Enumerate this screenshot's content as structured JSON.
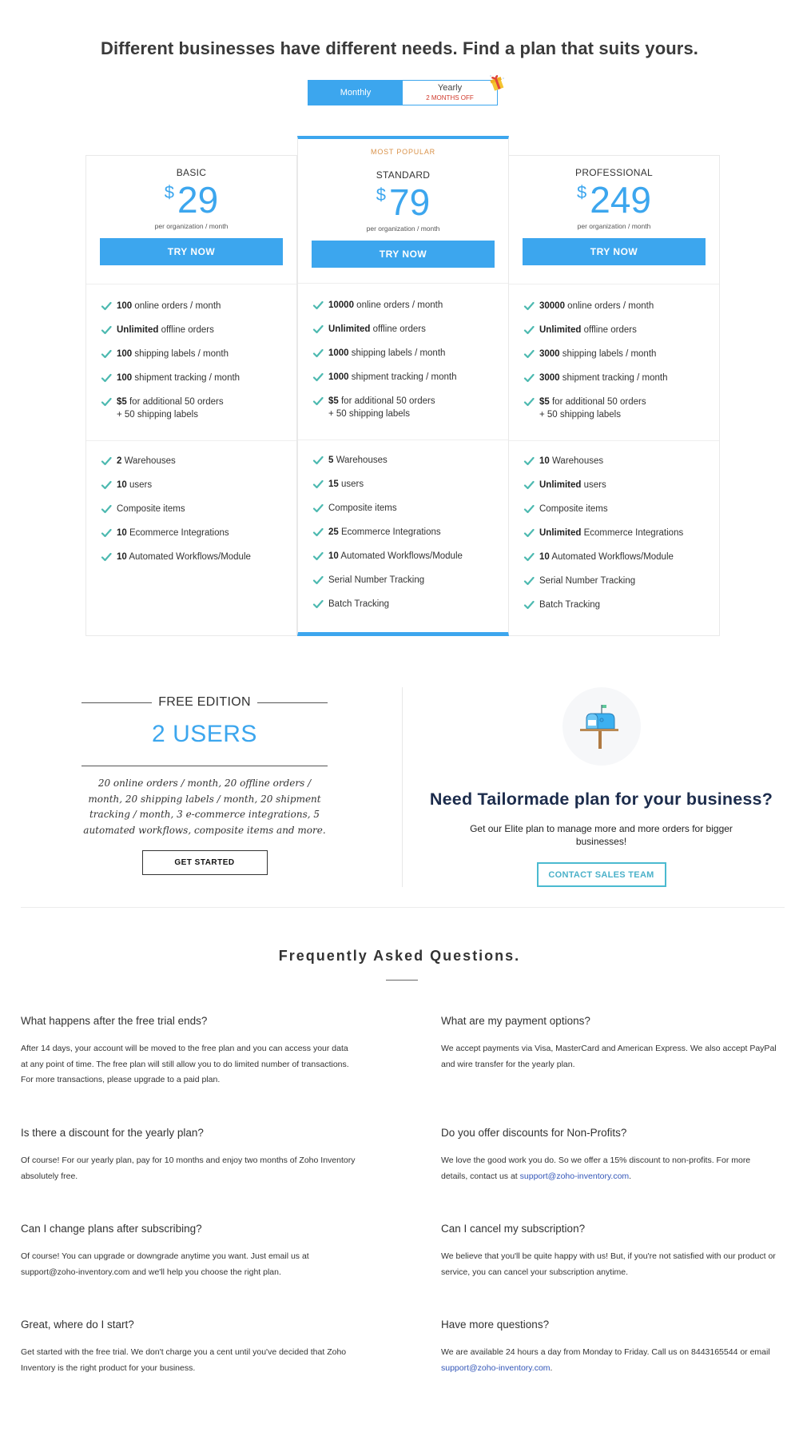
{
  "headline": "Different businesses have different needs. Find a plan that suits yours.",
  "billing": {
    "monthly_label": "Monthly",
    "yearly_label": "Yearly",
    "yearly_badge": "2 MONTHS OFF",
    "selected": "Monthly"
  },
  "colors": {
    "accent": "#3ca6ee",
    "popular": "#d9924a",
    "check": "#4cb9b0",
    "tailor_title": "#1c2c4c",
    "contact_button": "#4bbad0",
    "discount_red": "#d0392b",
    "link": "#3457b8"
  },
  "plans": [
    {
      "name": "BASIC",
      "currency": "$",
      "price": "29",
      "period": "per organization / month",
      "cta": "TRY NOW",
      "features_a": [
        {
          "bold": "100",
          "text": " online orders / month"
        },
        {
          "bold": "Unlimited",
          "text": " offline orders"
        },
        {
          "bold": "100",
          "text": " shipping labels / month"
        },
        {
          "bold": "100",
          "text": " shipment tracking / month"
        },
        {
          "bold": "$5",
          "text": " for additional 50 orders",
          "line2": "+ 50 shipping labels"
        }
      ],
      "features_b": [
        {
          "bold": "2",
          "text": " Warehouses"
        },
        {
          "bold": "10",
          "text": " users"
        },
        {
          "bold": "",
          "text": "Composite items"
        },
        {
          "bold": "10",
          "text": " Ecommerce Integrations"
        },
        {
          "bold": "10",
          "text": " Automated Workflows/Module"
        }
      ]
    },
    {
      "name": "STANDARD",
      "badge": "MOST POPULAR",
      "currency": "$",
      "price": "79",
      "period": "per organization / month",
      "cta": "TRY NOW",
      "features_a": [
        {
          "bold": "10000",
          "text": " online orders / month"
        },
        {
          "bold": "Unlimited",
          "text": " offline orders"
        },
        {
          "bold": "1000",
          "text": " shipping labels / month"
        },
        {
          "bold": "1000",
          "text": " shipment tracking / month"
        },
        {
          "bold": "$5",
          "text": " for additional 50 orders",
          "line2": "+ 50 shipping labels"
        }
      ],
      "features_b": [
        {
          "bold": "5",
          "text": " Warehouses"
        },
        {
          "bold": "15",
          "text": " users"
        },
        {
          "bold": "",
          "text": "Composite items"
        },
        {
          "bold": "25",
          "text": " Ecommerce Integrations"
        },
        {
          "bold": "10",
          "text": " Automated Workflows/Module"
        },
        {
          "bold": "",
          "text": "Serial Number Tracking"
        },
        {
          "bold": "",
          "text": "Batch Tracking"
        }
      ]
    },
    {
      "name": "PROFESSIONAL",
      "currency": "$",
      "price": "249",
      "period": "per organization / month",
      "cta": "TRY NOW",
      "features_a": [
        {
          "bold": "30000",
          "text": " online orders / month"
        },
        {
          "bold": "Unlimited",
          "text": " offline orders"
        },
        {
          "bold": "3000",
          "text": " shipping labels / month"
        },
        {
          "bold": "3000",
          "text": " shipment tracking / month"
        },
        {
          "bold": "$5",
          "text": " for additional 50 orders",
          "line2": "+ 50 shipping labels"
        }
      ],
      "features_b": [
        {
          "bold": "10",
          "text": " Warehouses"
        },
        {
          "bold": "Unlimited",
          "text": " users"
        },
        {
          "bold": "",
          "text": "Composite items"
        },
        {
          "bold": "Unlimited",
          "text": " Ecommerce Integrations"
        },
        {
          "bold": "10",
          "text": " Automated Workflows/Module"
        },
        {
          "bold": "",
          "text": "Serial Number Tracking"
        },
        {
          "bold": "",
          "text": "Batch Tracking"
        }
      ]
    }
  ],
  "free_edition": {
    "title": "FREE EDITION",
    "users": "2 USERS",
    "description": "20 online orders / month, 20 offline orders / month, 20 shipping labels / month, 20 shipment tracking / month, 3 e-commerce integrations, 5 automated workflows, composite items and more.",
    "cta": "GET STARTED"
  },
  "tailormade": {
    "icon": "mailbox-icon",
    "title": "Need Tailormade plan for your business?",
    "description": "Get our Elite plan to manage more and more orders for bigger businesses!",
    "cta": "CONTACT SALES TEAM"
  },
  "faq": {
    "title": "Frequently Asked Questions.",
    "items": [
      {
        "q": "What happens after the free trial ends?",
        "a": "After 14 days, your account will be moved to the free plan and you can access your data at any point of time. The free plan will still allow you to do limited number of transactions. For more transactions, please upgrade to a paid plan."
      },
      {
        "q": "What are my payment options?",
        "a": "We accept payments via Visa, MasterCard and American Express. We also accept PayPal and wire transfer for the yearly plan."
      },
      {
        "q": "Is there a discount for the yearly plan?",
        "a": "Of course! For our yearly plan, pay for 10 months and enjoy two months of Zoho Inventory absolutely free."
      },
      {
        "q": "Do you offer discounts for Non-Profits?",
        "a": "We love the good work you do. So we offer a 15% discount to non-profits. For more details, contact us at ",
        "link": "support@zoho-inventory.com",
        "after": "."
      },
      {
        "q": "Can I change plans after subscribing?",
        "a": "Of course! You can upgrade or downgrade anytime you want. Just email us at support@zoho-inventory.com and we'll help you choose the right plan."
      },
      {
        "q": "Can I cancel my subscription?",
        "a": "We believe that you'll be quite happy with us! But, if you're not satisfied with our product or service, you can cancel your subscription anytime."
      },
      {
        "q": "Great, where do I start?",
        "a": "Get started with the free trial. We don't charge you a cent until you've decided that Zoho Inventory is the right product for your business."
      },
      {
        "q": "Have more questions?",
        "a": "We are available 24 hours a day from Monday to Friday. Call us on 8443165544 or email ",
        "link": "support@zoho-inventory.com",
        "after": "."
      }
    ]
  }
}
